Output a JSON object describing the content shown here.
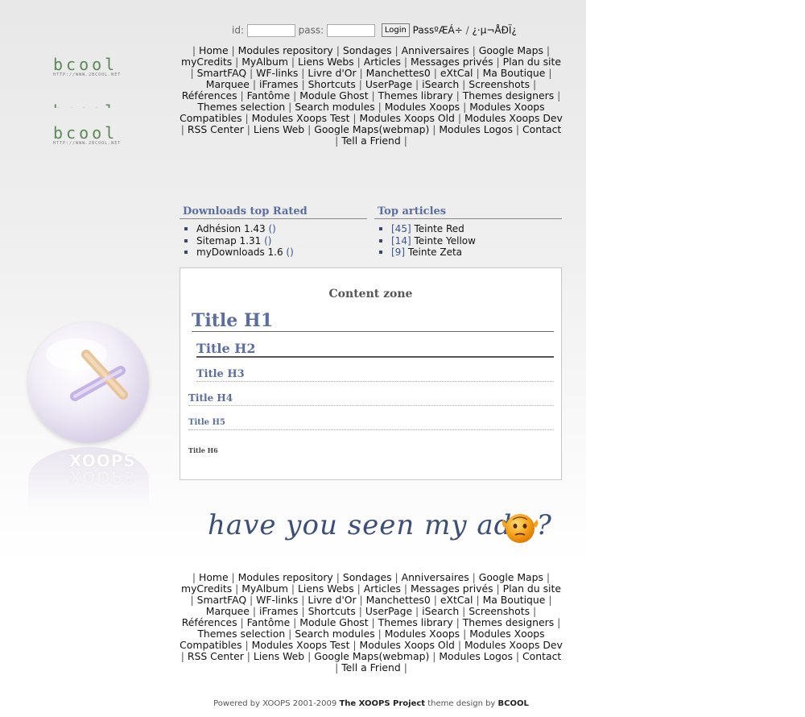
{
  "login": {
    "id_label": "id:",
    "pass_label": "pass:",
    "id_value": "",
    "pass_value": "",
    "login_button": "Login",
    "lost_pass_link": "PassºÆÁ÷",
    "separator": "/",
    "register_link": "¿·µ¬ÅÐÏ¿"
  },
  "logo": {
    "word": "bcool",
    "url": "HTTP://WWW.2BCOOL.NET"
  },
  "nav": [
    "Home",
    "Modules repository",
    "Sondages",
    "Anniversaires",
    "Google Maps",
    "myCredits",
    "MyAlbum",
    "Liens Webs",
    "Articles",
    "Messages privés",
    "Plan du site",
    "SmartFAQ",
    "WF-links",
    "Livre d'Or",
    "Manchettes0",
    "eXtCal",
    "Ma Boutique",
    "Marquee",
    "iFrames",
    "Shortcuts",
    "UserPage",
    "iSearch",
    "Screenshots",
    "Références",
    "Fantôme",
    "Module Ghost",
    "Themes library",
    "Themes designers",
    "Themes selection",
    "Search modules",
    "Modules Xoops",
    "Modules Xoops Compatibles",
    "Modules Xoops Test",
    "Modules Xoops Old",
    "Modules Xoops Dev",
    "RSS Center",
    "Liens Web",
    "Google Maps(webmap)",
    "Modules Logos",
    "Contact",
    "Tell a Friend"
  ],
  "downloads_block": {
    "title": "Downloads top Rated",
    "items": [
      {
        "label": "Adhésion 1.43",
        "extra": "()"
      },
      {
        "label": "Sitemap 1.31",
        "extra": "()"
      },
      {
        "label": "myDownloads 1.6",
        "extra": "()"
      }
    ]
  },
  "articles_block": {
    "title": "Top articles",
    "items": [
      {
        "count": "[45]",
        "label": "Teinte Red"
      },
      {
        "count": "[14]",
        "label": "Teinte Yellow"
      },
      {
        "count": "[9]",
        "label": "Teinte Zeta"
      }
    ]
  },
  "content": {
    "zone_title": "Content zone",
    "h1": "Title H1",
    "h2": "Title H2",
    "h3": "Title H3",
    "h4": "Title H4",
    "h5": "Title H5",
    "h6": "Title H6"
  },
  "side_brand": {
    "xoops_word": "XOOPS"
  },
  "ads": {
    "text": "have you seen my ads ?"
  },
  "footer": {
    "powered": "Powered by XOOPS 2001-2009",
    "project": "The XOOPS Project",
    "design": "theme design by",
    "designer": "BCOOL"
  },
  "colors": {
    "block_title": "#5a6ea0",
    "logo_green": "#5a8a55",
    "ads_text": "#3b4f7a"
  }
}
